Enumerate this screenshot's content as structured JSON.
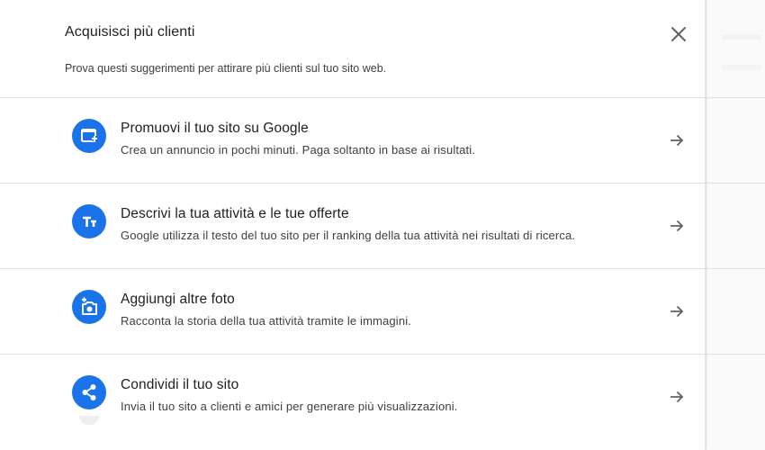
{
  "dialog": {
    "title": "Acquisisci più clienti",
    "subtitle": "Prova questi suggerimenti per attirare più clienti sul tuo sito web.",
    "close_icon": "close-icon"
  },
  "accent_color": "#1a73e8",
  "items": [
    {
      "icon": "ad-window-plus-icon",
      "title": "Promuovi il tuo sito su Google",
      "description": "Crea un annuncio in pochi minuti. Paga soltanto in base ai risultati."
    },
    {
      "icon": "text-size-icon",
      "title": "Descrivi la tua attività e le tue offerte",
      "description": "Google utilizza il testo del tuo sito per il ranking della tua attività nei risultati di ricerca."
    },
    {
      "icon": "add-photo-icon",
      "title": "Aggiungi altre foto",
      "description": "Racconta la storia della tua attività tramite le immagini."
    },
    {
      "icon": "share-icon",
      "title": "Condividi il tuo sito",
      "description": "Invia il tuo sito a clienti e amici per generare più visualizzazioni."
    }
  ]
}
